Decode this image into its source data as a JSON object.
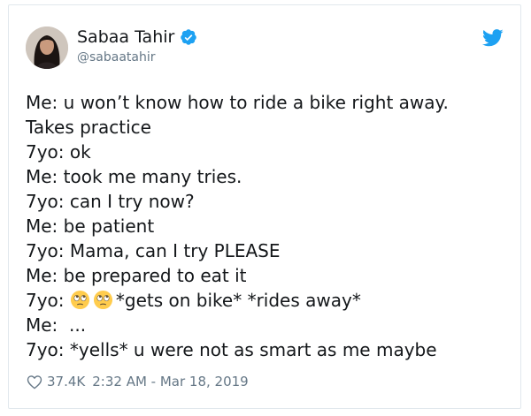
{
  "author": {
    "display_name": "Sabaa Tahir",
    "handle": "@sabaatahir",
    "verified": true
  },
  "tweet": {
    "lines": [
      "Me: u won’t know how to ride a bike right away.",
      "Takes practice",
      "7yo: ok",
      "Me: took me many tries.",
      "7yo: can I try now?",
      "Me: be patient",
      "7yo: Mama, can I try PLEASE",
      "Me: be prepared to eat it"
    ],
    "emoji_line": {
      "prefix": "7yo: ",
      "emojis": [
        "rolling-eyes-emoji",
        "rolling-eyes-emoji"
      ],
      "suffix": "*gets on bike* *rides away*"
    },
    "lines_after": [
      "Me:  ...",
      "7yo: *yells* u were not as smart as me maybe"
    ]
  },
  "footer": {
    "likes": "37.4K",
    "timestamp": "2:32 AM - Mar 18, 2019"
  },
  "icons": {
    "verified": "verified-badge-icon",
    "brand": "twitter-bird-icon",
    "like": "heart-icon"
  },
  "colors": {
    "brand_blue": "#1da1f2",
    "text": "#14171a",
    "muted": "#657786",
    "border": "#e1e8ed"
  }
}
